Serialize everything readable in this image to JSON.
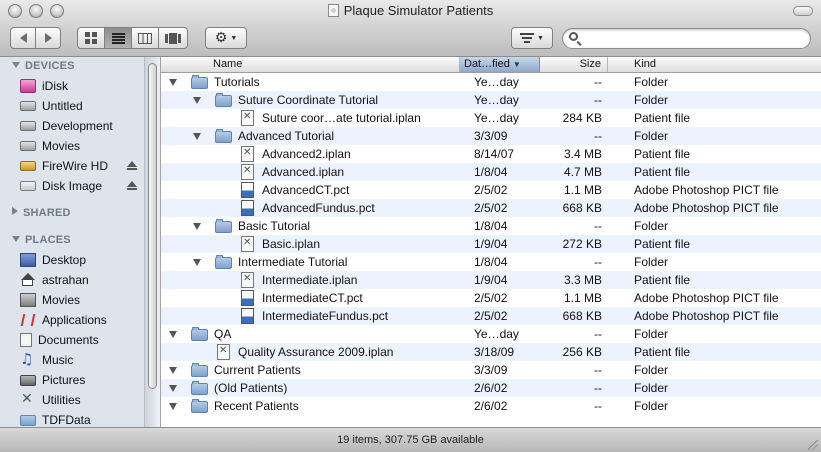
{
  "window": {
    "title": "Plaque Simulator Patients"
  },
  "toolbar": {
    "search_value": "",
    "search_placeholder": ""
  },
  "sidebar": {
    "sections": [
      {
        "heading": "DEVICES",
        "expanded": true,
        "items": [
          {
            "label": "iDisk",
            "icon": "idisk-icon",
            "eject": false
          },
          {
            "label": "Untitled",
            "icon": "drive-icon",
            "eject": false
          },
          {
            "label": "Development",
            "icon": "drive-icon",
            "eject": false
          },
          {
            "label": "Movies",
            "icon": "drive-icon",
            "eject": false
          },
          {
            "label": "FireWire HD",
            "icon": "firewire-drive-icon",
            "eject": true
          },
          {
            "label": "Disk Image",
            "icon": "disk-image-icon",
            "eject": true
          }
        ]
      },
      {
        "heading": "SHARED",
        "expanded": false,
        "items": []
      },
      {
        "heading": "PLACES",
        "expanded": true,
        "items": [
          {
            "label": "Desktop",
            "icon": "desktop-icon"
          },
          {
            "label": "astrahan",
            "icon": "home-icon"
          },
          {
            "label": "Movies",
            "icon": "movies-icon"
          },
          {
            "label": "Applications",
            "icon": "applications-icon"
          },
          {
            "label": "Documents",
            "icon": "documents-icon"
          },
          {
            "label": "Music",
            "icon": "music-icon"
          },
          {
            "label": "Pictures",
            "icon": "pictures-icon"
          },
          {
            "label": "Utilities",
            "icon": "utilities-icon"
          },
          {
            "label": "TDFData",
            "icon": "folder-icon"
          }
        ]
      }
    ]
  },
  "columns": {
    "name": "Name",
    "date": "Dat…fied",
    "size": "Size",
    "kind": "Kind"
  },
  "files": [
    {
      "level": 0,
      "disclosure": true,
      "type": "folder",
      "name": "Tutorials",
      "date": "Ye…day",
      "size": "--",
      "kind": "Folder"
    },
    {
      "level": 1,
      "disclosure": true,
      "type": "folder",
      "name": "Suture Coordinate Tutorial",
      "date": "Ye…day",
      "size": "--",
      "kind": "Folder"
    },
    {
      "level": 2,
      "disclosure": false,
      "type": "patient",
      "name": "Suture coor…ate tutorial.iplan",
      "date": "Ye…day",
      "size": "284 KB",
      "kind": "Patient file"
    },
    {
      "level": 1,
      "disclosure": true,
      "type": "folder",
      "name": "Advanced Tutorial",
      "date": "3/3/09",
      "size": "--",
      "kind": "Folder"
    },
    {
      "level": 2,
      "disclosure": false,
      "type": "patient",
      "name": "Advanced2.iplan",
      "date": "8/14/07",
      "size": "3.4 MB",
      "kind": "Patient file"
    },
    {
      "level": 2,
      "disclosure": false,
      "type": "patient",
      "name": "Advanced.iplan",
      "date": "1/8/04",
      "size": "4.7 MB",
      "kind": "Patient file"
    },
    {
      "level": 2,
      "disclosure": false,
      "type": "pict",
      "name": "AdvancedCT.pct",
      "date": "2/5/02",
      "size": "1.1 MB",
      "kind": "Adobe Photoshop PICT file"
    },
    {
      "level": 2,
      "disclosure": false,
      "type": "pict",
      "name": "AdvancedFundus.pct",
      "date": "2/5/02",
      "size": "668 KB",
      "kind": "Adobe Photoshop PICT file"
    },
    {
      "level": 1,
      "disclosure": true,
      "type": "folder",
      "name": "Basic Tutorial",
      "date": "1/8/04",
      "size": "--",
      "kind": "Folder"
    },
    {
      "level": 2,
      "disclosure": false,
      "type": "patient",
      "name": "Basic.iplan",
      "date": "1/9/04",
      "size": "272 KB",
      "kind": "Patient file"
    },
    {
      "level": 1,
      "disclosure": true,
      "type": "folder",
      "name": "Intermediate Tutorial",
      "date": "1/8/04",
      "size": "--",
      "kind": "Folder"
    },
    {
      "level": 2,
      "disclosure": false,
      "type": "patient",
      "name": "Intermediate.iplan",
      "date": "1/9/04",
      "size": "3.3 MB",
      "kind": "Patient file"
    },
    {
      "level": 2,
      "disclosure": false,
      "type": "pict",
      "name": "IntermediateCT.pct",
      "date": "2/5/02",
      "size": "1.1 MB",
      "kind": "Adobe Photoshop PICT file"
    },
    {
      "level": 2,
      "disclosure": false,
      "type": "pict",
      "name": "IntermediateFundus.pct",
      "date": "2/5/02",
      "size": "668 KB",
      "kind": "Adobe Photoshop PICT file"
    },
    {
      "level": 0,
      "disclosure": true,
      "type": "folder",
      "name": "QA",
      "date": "Ye…day",
      "size": "--",
      "kind": "Folder"
    },
    {
      "level": 1,
      "disclosure": false,
      "type": "patient",
      "name": "Quality Assurance 2009.iplan",
      "date": "3/18/09",
      "size": "256 KB",
      "kind": "Patient file"
    },
    {
      "level": 0,
      "disclosure": true,
      "type": "folder",
      "name": "Current Patients",
      "date": "3/3/09",
      "size": "--",
      "kind": "Folder"
    },
    {
      "level": 0,
      "disclosure": true,
      "type": "folder",
      "name": "(Old Patients)",
      "date": "2/6/02",
      "size": "--",
      "kind": "Folder"
    },
    {
      "level": 0,
      "disclosure": true,
      "type": "folder",
      "name": "Recent Patients",
      "date": "2/6/02",
      "size": "--",
      "kind": "Folder"
    }
  ],
  "status": {
    "text": "19 items, 307.75 GB available"
  }
}
